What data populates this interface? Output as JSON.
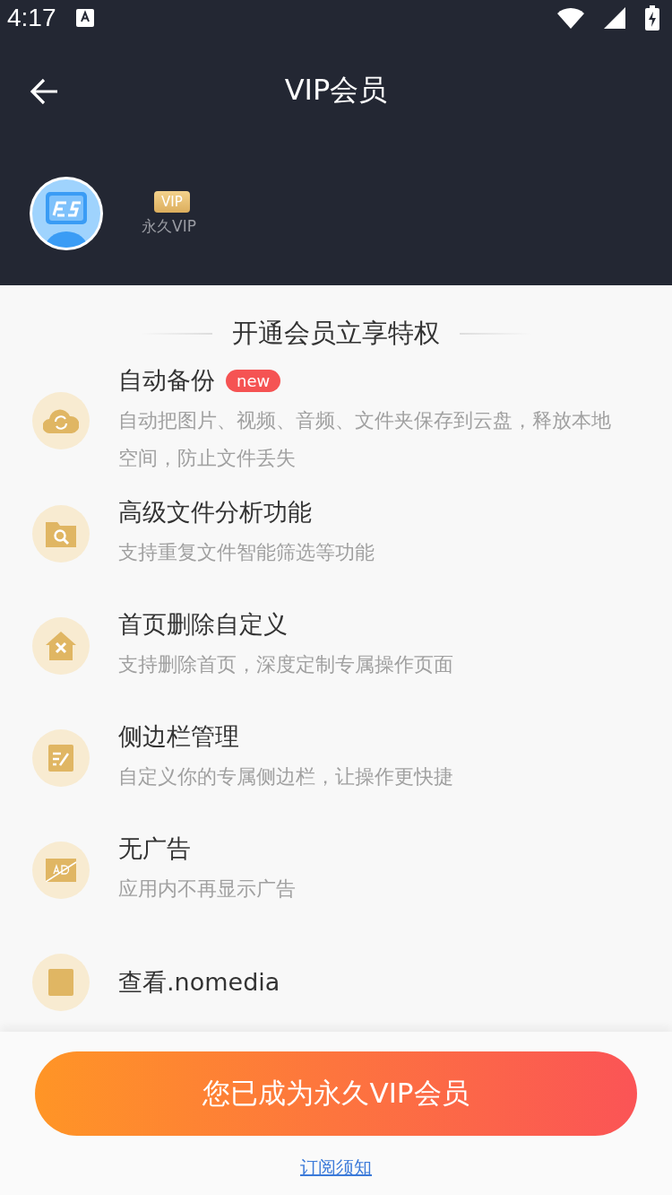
{
  "status_bar": {
    "time": "4:17"
  },
  "header": {
    "title": "VIP会员"
  },
  "profile": {
    "badge": "VIP",
    "membership": "永久VIP"
  },
  "section_title": "开通会员立享特权",
  "features": [
    {
      "title": "自动备份",
      "badge": "new",
      "description": "自动把图片、视频、音频、文件夹保存到云盘，释放本地空间，防止文件丢失"
    },
    {
      "title": "高级文件分析功能",
      "description": "支持重复文件智能筛选等功能"
    },
    {
      "title": "首页删除自定义",
      "description": "支持删除首页，深度定制专属操作页面"
    },
    {
      "title": "侧边栏管理",
      "description": "自定义你的专属侧边栏，让操作更快捷"
    },
    {
      "title": "无广告",
      "description": "应用内不再显示广告"
    },
    {
      "title": "查看.nomedia"
    }
  ],
  "action_button": "您已成为永久VIP会员",
  "subscription_link": "订阅须知"
}
